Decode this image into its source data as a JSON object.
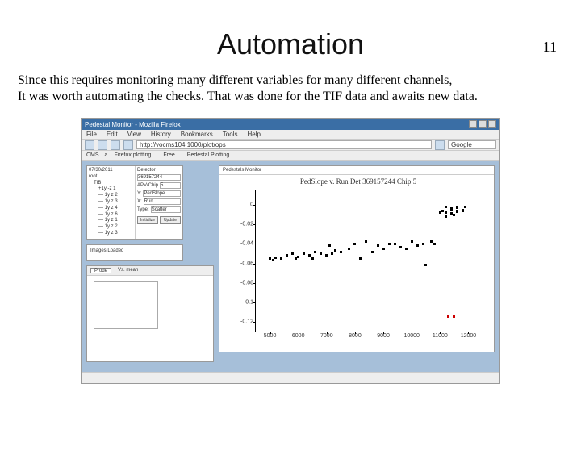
{
  "page_number": "11",
  "title": "Automation",
  "body_line1": "Since this requires monitoring many different variables for many different channels,",
  "body_line2": "It was worth automating the checks. That was done for the TIF data and awaits new data.",
  "browser": {
    "window_title": "Pedestal Monitor - Mozilla Firefox",
    "menus": [
      "File",
      "Edit",
      "View",
      "History",
      "Bookmarks",
      "Tools",
      "Help"
    ],
    "address": "http://vocms104:1000/plot/ops",
    "search_label": "Google",
    "bookmarks": [
      "CMS…a",
      "Firefox plotting…",
      "Free…",
      "Pedestal Plotting"
    ]
  },
  "sidebar": {
    "date": "07/30/2011",
    "tree": [
      "root",
      "TIB",
      "+1y -z 1",
      "— 1y z 2",
      "— 1y z 3",
      "— 1y z 4",
      "— 1y z 6",
      "— 1y z 1",
      "— 1y z 2",
      "— 1y z 3"
    ],
    "form": {
      "label1": "Detector",
      "val1": "369157244",
      "label2": "APV/Chip",
      "val2": "5",
      "y_label": "Y:",
      "y_val": "PedSlope",
      "x_label": "X:",
      "x_val": "Run",
      "type_label": "Type:",
      "type_val": "Scatter",
      "btn_init": "Initialize",
      "btn_update": "Update"
    },
    "status": "Images Loaded",
    "panel_tabs": {
      "tab1": "Prode",
      "tab2": "Vs. mean"
    }
  },
  "chart": {
    "tab": "Pedestals Monitor",
    "title": "PedSlope v. Run Det 369157244 Chip 5"
  },
  "chart_data": {
    "type": "scatter",
    "xlabel": "",
    "ylabel": "",
    "xlim": [
      4500,
      12500
    ],
    "ylim": [
      -0.13,
      0.015
    ],
    "yticks": [
      0,
      -0.02,
      -0.04,
      -0.06,
      -0.08,
      -0.1,
      -0.12
    ],
    "xticks": [
      5000,
      6000,
      7000,
      8000,
      9000,
      10000,
      11000,
      12000
    ],
    "title": "PedSlope v. Run Det 369157244 Chip 5",
    "series": [
      {
        "name": "main",
        "color": "#000",
        "x": [
          5000,
          5100,
          5200,
          5400,
          5600,
          5800,
          5900,
          6000,
          6200,
          6400,
          6500,
          6600,
          6800,
          7000,
          7100,
          7200,
          7300,
          7500,
          7800,
          8000,
          8200,
          8400,
          8600,
          8800,
          9000,
          9200,
          9400,
          9600,
          9800,
          10000,
          10200,
          10400,
          10500,
          10700,
          10800,
          11000,
          11100,
          11200,
          11400,
          11500,
          11600,
          11800,
          11200,
          11400,
          11600,
          11800,
          11200,
          11400,
          11600,
          11800,
          11900
        ],
        "y": [
          -0.055,
          -0.057,
          -0.054,
          -0.055,
          -0.052,
          -0.05,
          -0.055,
          -0.053,
          -0.05,
          -0.052,
          -0.055,
          -0.048,
          -0.05,
          -0.052,
          -0.042,
          -0.05,
          -0.047,
          -0.048,
          -0.045,
          -0.04,
          -0.055,
          -0.038,
          -0.048,
          -0.042,
          -0.045,
          -0.04,
          -0.04,
          -0.043,
          -0.045,
          -0.038,
          -0.042,
          -0.04,
          -0.062,
          -0.038,
          -0.04,
          -0.008,
          -0.006,
          -0.012,
          -0.005,
          -0.01,
          -0.007,
          -0.006,
          -0.008,
          -0.009,
          -0.006,
          -0.005,
          -0.002,
          -0.004,
          -0.003,
          -0.006,
          -0.002
        ]
      },
      {
        "name": "outlier",
        "color": "#c00",
        "x": [
          11300,
          11500
        ],
        "y": [
          -0.115,
          -0.115
        ]
      }
    ]
  }
}
